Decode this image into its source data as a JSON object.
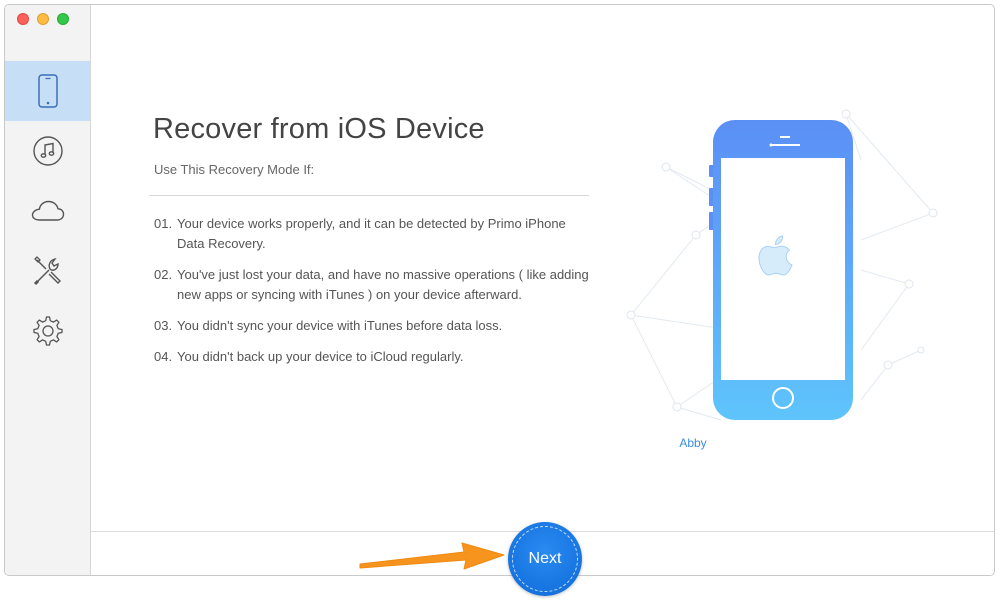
{
  "sidebar": {
    "items": [
      {
        "icon": "iphone-icon",
        "active": true
      },
      {
        "icon": "music-note-icon",
        "active": false
      },
      {
        "icon": "cloud-icon",
        "active": false
      },
      {
        "icon": "tools-icon",
        "active": false
      },
      {
        "icon": "gear-icon",
        "active": false
      }
    ]
  },
  "main": {
    "title": "Recover from iOS Device",
    "subtitle": "Use This Recovery Mode If:",
    "reasons": [
      {
        "num": "01.",
        "text": "Your device works properly, and it can be detected by Primo iPhone Data Recovery."
      },
      {
        "num": "02.",
        "text": "You've just lost your data, and have no massive operations ( like adding new apps or syncing with iTunes ) on your device afterward."
      },
      {
        "num": "03.",
        "text": "You didn't sync your device with iTunes before data loss."
      },
      {
        "num": "04.",
        "text": "You didn't back up your device to iCloud regularly."
      }
    ]
  },
  "device": {
    "name": "Abby",
    "icon": "apple-logo-icon"
  },
  "footer": {
    "next_label": "Next"
  },
  "colors": {
    "accent": "#1673e0",
    "sidebar_active": "#c7dff6",
    "phone_top": "#5b8ff5",
    "phone_bottom": "#5ec4fb",
    "annotation_arrow": "#f7941d"
  }
}
